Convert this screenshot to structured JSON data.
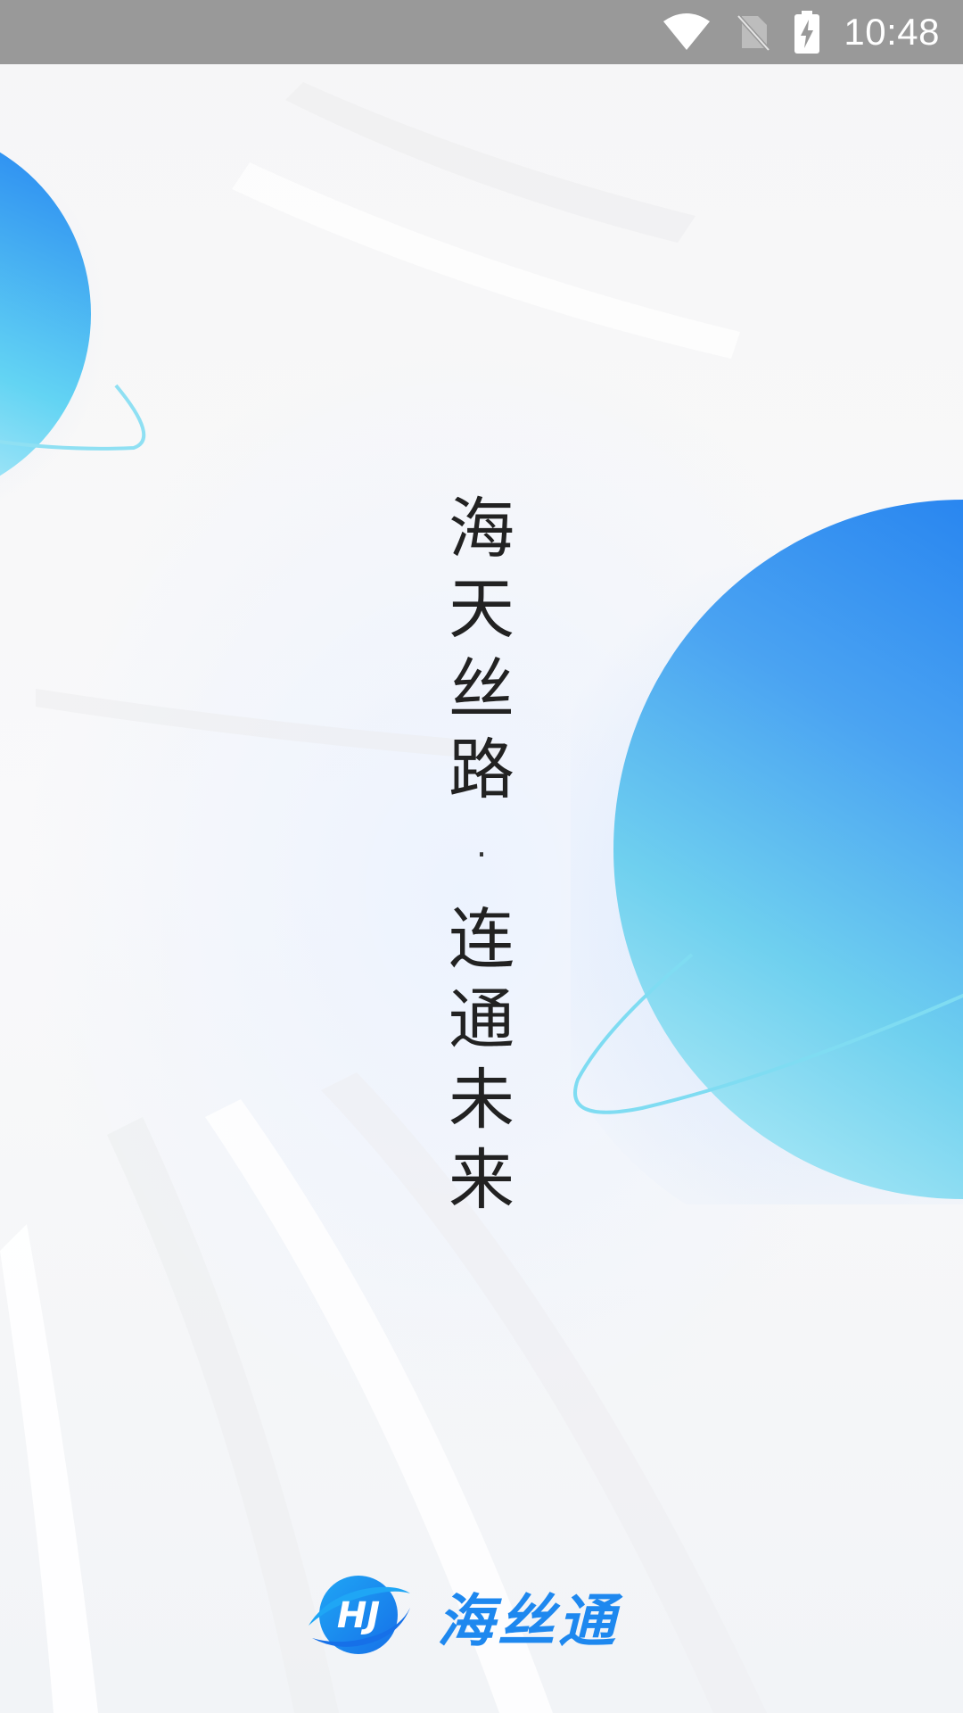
{
  "status_bar": {
    "time": "10:48",
    "icons": [
      "wifi-icon",
      "no-sim-icon",
      "battery-charging-icon"
    ]
  },
  "slogan": {
    "line1": [
      "海",
      "天",
      "丝",
      "路"
    ],
    "separator": "·",
    "line2": [
      "连",
      "通",
      "未",
      "来"
    ]
  },
  "brand": {
    "logo_icon": "hst-logo-icon",
    "name": "海丝通",
    "accent_color": "#1e88ef"
  },
  "colors": {
    "status_bar": "#999999",
    "planet_blue": "#1a7ef0",
    "planet_cyan": "#5fdcef"
  }
}
